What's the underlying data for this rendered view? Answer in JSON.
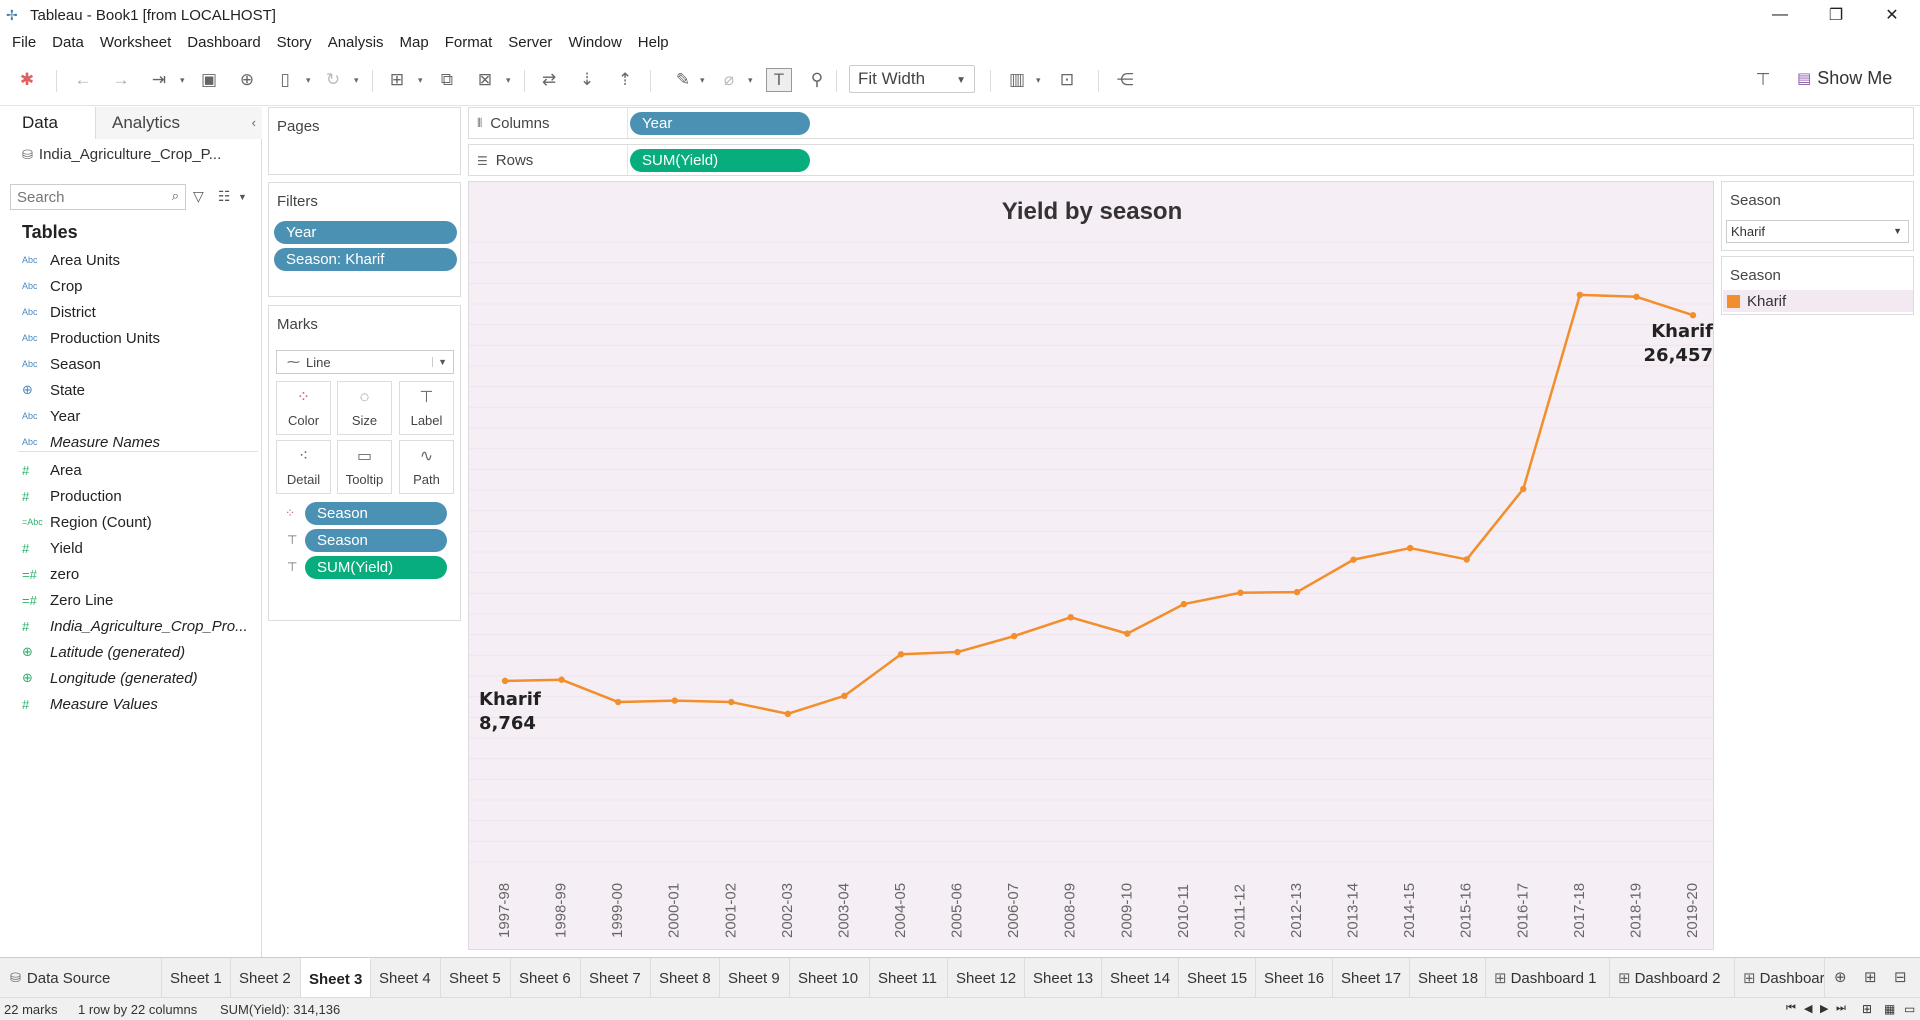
{
  "window": {
    "title": "Tableau - Book1 [from LOCALHOST]"
  },
  "menu": [
    "File",
    "Data",
    "Worksheet",
    "Dashboard",
    "Story",
    "Analysis",
    "Map",
    "Format",
    "Server",
    "Window",
    "Help"
  ],
  "toolbar": {
    "fit_mode": "Fit Width",
    "show_me": "Show Me"
  },
  "data_pane": {
    "tab_data": "Data",
    "tab_analytics": "Analytics",
    "datasource": "India_Agriculture_Crop_P...",
    "search_placeholder": "Search",
    "tables_heading": "Tables",
    "fields": [
      {
        "name": "Area Units",
        "type": "Abc"
      },
      {
        "name": "Crop",
        "type": "Abc"
      },
      {
        "name": "District",
        "type": "Abc"
      },
      {
        "name": "Production Units",
        "type": "Abc"
      },
      {
        "name": "Season",
        "type": "Abc"
      },
      {
        "name": "State",
        "type": "geo"
      },
      {
        "name": "Year",
        "type": "Abc"
      },
      {
        "name": "Measure Names",
        "type": "Abc"
      },
      {
        "name": "Area",
        "type": "#"
      },
      {
        "name": "Production",
        "type": "#"
      },
      {
        "name": "Region (Count)",
        "type": "=Abc"
      },
      {
        "name": "Yield",
        "type": "#"
      },
      {
        "name": "zero",
        "type": "=#"
      },
      {
        "name": "Zero Line",
        "type": "=#"
      },
      {
        "name": "India_Agriculture_Crop_Pro...",
        "type": "#"
      },
      {
        "name": "Latitude (generated)",
        "type": "geo"
      },
      {
        "name": "Longitude (generated)",
        "type": "geo"
      },
      {
        "name": "Measure Values",
        "type": "#"
      }
    ]
  },
  "pages": {
    "title": "Pages"
  },
  "filters": {
    "title": "Filters",
    "pills": [
      "Year",
      "Season: Kharif"
    ]
  },
  "marks": {
    "title": "Marks",
    "type": "Line",
    "buttons": [
      "Color",
      "Size",
      "Label",
      "Detail",
      "Tooltip",
      "Path"
    ],
    "pills": [
      "Season",
      "Season",
      "SUM(Yield)"
    ]
  },
  "columns": {
    "label": "Columns",
    "pill": "Year"
  },
  "rows": {
    "label": "Rows",
    "pill": "SUM(Yield)"
  },
  "season_filter": {
    "title": "Season",
    "value": "Kharif"
  },
  "season_legend": {
    "title": "Season",
    "item": "Kharif",
    "color": "#f28e2b"
  },
  "chart_data": {
    "type": "line",
    "title": "Yield by season",
    "categories": [
      "1997-98",
      "1998-99",
      "1999-00",
      "2000-01",
      "2001-02",
      "2002-03",
      "2003-04",
      "2004-05",
      "2005-06",
      "2006-07",
      "2008-09",
      "2009-10",
      "2010-11",
      "2011-12",
      "2012-13",
      "2013-14",
      "2014-15",
      "2015-16",
      "2016-17",
      "2017-18",
      "2018-19",
      "2019-20"
    ],
    "series": [
      {
        "name": "Kharif",
        "color": "#f28e2b",
        "values": [
          8764,
          8820,
          7740,
          7810,
          7740,
          7170,
          8040,
          10050,
          10160,
          10930,
          11840,
          11050,
          12480,
          13030,
          13060,
          14630,
          15190,
          14640,
          18050,
          27440,
          27350,
          26457
        ]
      }
    ],
    "labels": [
      {
        "series": "Kharif",
        "value": "8,764"
      },
      {
        "series": "Kharif",
        "value": "26,457"
      }
    ],
    "ylim": [
      0,
      30000
    ],
    "y_axis_shown": false,
    "grid": true
  },
  "sheet_tabs": [
    "Data Source",
    "Sheet 1",
    "Sheet 2",
    "Sheet 3",
    "Sheet 4",
    "Sheet 5",
    "Sheet 6",
    "Sheet 7",
    "Sheet 8",
    "Sheet 9",
    "Sheet 10",
    "Sheet 11",
    "Sheet 12",
    "Sheet 13",
    "Sheet 14",
    "Sheet 15",
    "Sheet 16",
    "Sheet 17",
    "Sheet 18",
    "Dashboard 1",
    "Dashboard 2",
    "Dashboar"
  ],
  "active_tab": "Sheet 3",
  "status": {
    "marks": "22 marks",
    "dims": "1 row by 22 columns",
    "sum": "SUM(Yield): 314,136"
  }
}
